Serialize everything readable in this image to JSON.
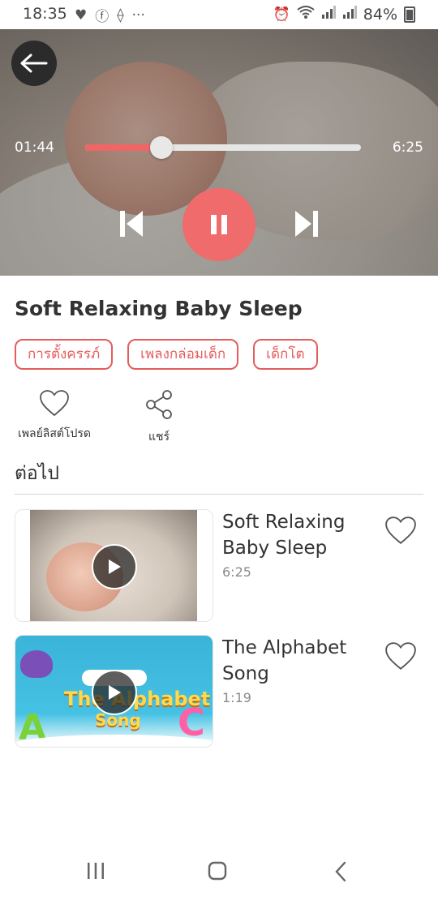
{
  "status_bar": {
    "time": "18:35",
    "battery": "84%",
    "dots": "···"
  },
  "player": {
    "current_time": "01:44",
    "total_time": "6:25",
    "progress_fraction": 0.277,
    "accent_color": "#f06565"
  },
  "track": {
    "title": "Soft Relaxing Baby Sleep",
    "tags": [
      "การตั้งครรภ์",
      "เพลงกล่อมเด็ก",
      "เด็กโต"
    ]
  },
  "actions": {
    "favorite_label": "เพลย์ลิสต์โปรด",
    "share_label": "แชร์"
  },
  "up_next": {
    "heading": "ต่อไป",
    "items": [
      {
        "title": "Soft Relaxing Baby Sleep",
        "duration": "6:25"
      },
      {
        "title": "The Alphabet Song",
        "duration": "1:19",
        "thumb_caption": "The Alphabet Song"
      }
    ]
  }
}
